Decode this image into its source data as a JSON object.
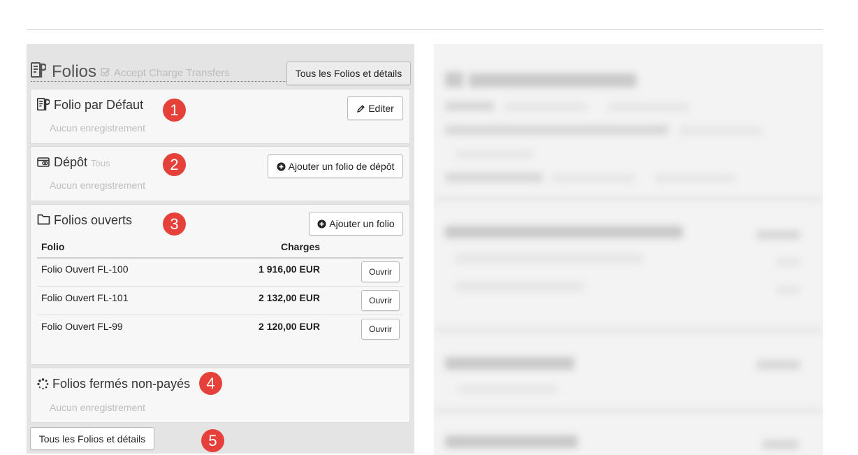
{
  "header": {
    "title": "Folios",
    "subtitle": "Accept Charge Transfers",
    "all_button": "Tous les Folios et détails"
  },
  "sections": {
    "default": {
      "title": "Folio par Défaut",
      "empty": "Aucun enregistrement",
      "button": "Editer",
      "badge": "1"
    },
    "deposit": {
      "title": "Dépôt",
      "subtitle": "Tous",
      "empty": "Aucun enregistrement",
      "button": "Ajouter un folio de dépôt",
      "badge": "2"
    },
    "open": {
      "title": "Folios ouverts",
      "button": "Ajouter un folio",
      "badge": "3",
      "columns": [
        "Folio",
        "Charges"
      ],
      "rows": [
        {
          "name": "Folio Ouvert FL-100",
          "charges": "1 916,00 EUR",
          "action": "Ouvrir"
        },
        {
          "name": "Folio Ouvert FL-101",
          "charges": "2 132,00 EUR",
          "action": "Ouvrir"
        },
        {
          "name": "Folio Ouvert FL-99",
          "charges": "2 120,00 EUR",
          "action": "Ouvrir"
        }
      ]
    },
    "closed": {
      "title": "Folios fermés non-payés",
      "empty": "Aucun enregistrement",
      "badge": "4"
    }
  },
  "footer": {
    "all_button": "Tous les Folios et détails",
    "badge": "5"
  },
  "colors": {
    "badge": "#e5413a",
    "panel": "#e4e4e4",
    "section": "#f7f7f7"
  },
  "icons": [
    "folio-icon",
    "check-square-icon",
    "pencil-icon",
    "card-icon",
    "plus-circle-icon",
    "folder-icon",
    "spinner-icon"
  ]
}
